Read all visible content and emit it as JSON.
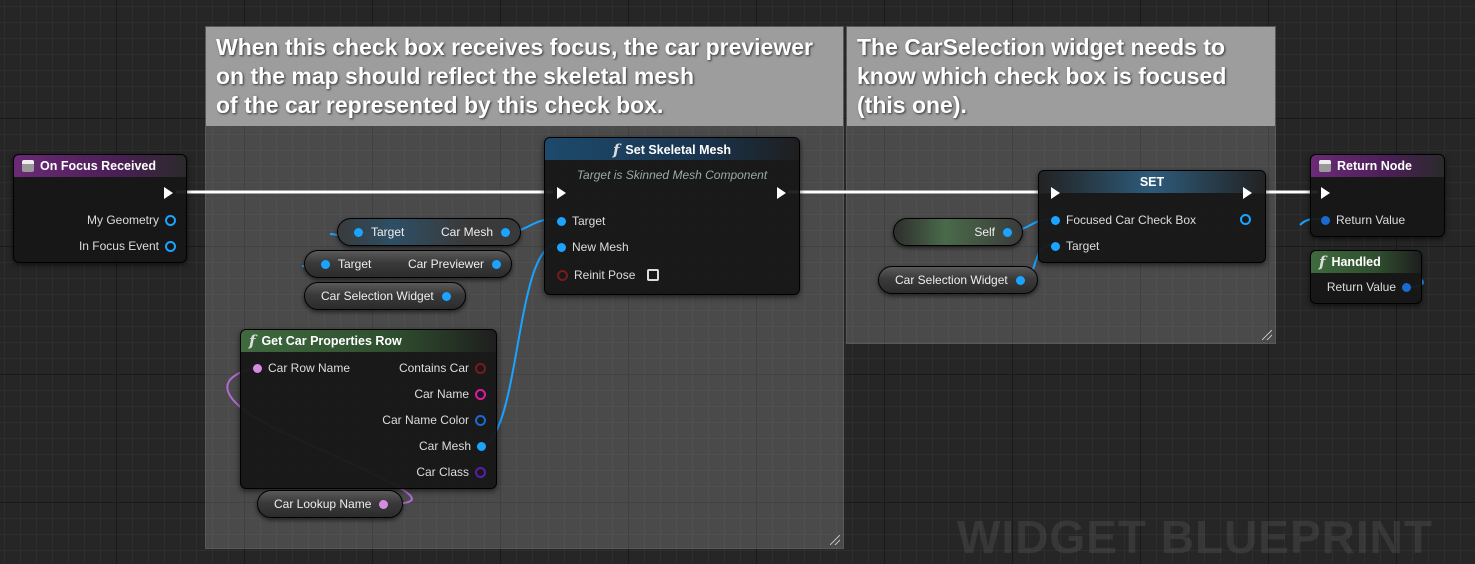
{
  "comments": {
    "left": "When this check box receives focus, the car previewer\non the map should reflect the skeletal mesh\nof the car represented by this check box.",
    "right": "The CarSelection widget needs to\nknow which check box is focused\n(this one)."
  },
  "on_focus": {
    "title": "On Focus Received",
    "pins": [
      "My Geometry",
      "In Focus Event"
    ]
  },
  "set_mesh": {
    "title": "Set Skeletal Mesh",
    "subtitle": "Target is Skinned Mesh Component",
    "pins": [
      "Target",
      "New Mesh",
      "Reinit Pose"
    ]
  },
  "get_row": {
    "title": "Get Car Properties Row",
    "input": "Car Row Name",
    "outputs": [
      "Contains Car",
      "Car Name",
      "Car Name Color",
      "Car Mesh",
      "Car Class"
    ]
  },
  "vars": {
    "car_mesh": {
      "left": "Target",
      "right": "Car Mesh"
    },
    "car_previewer": {
      "left": "Target",
      "right": "Car Previewer"
    },
    "car_sel_1": "Car Selection Widget",
    "car_lookup": "Car Lookup Name",
    "self": "Self",
    "car_sel_2": "Car Selection Widget"
  },
  "set_node": {
    "title": "SET",
    "pins": [
      "Focused Car Check Box",
      "Target"
    ]
  },
  "return_node": {
    "title": "Return Node",
    "pin": "Return Value"
  },
  "handled": {
    "title": "Handled",
    "pin": "Return Value"
  },
  "watermark": "WIDGET BLUEPRINT",
  "colors": {
    "object_pin": "#1aa3ff",
    "struct_pin": "#7a1a1a",
    "name_pin": "#d58be0",
    "text_pin": "#e01aa0",
    "class_pin": "#5a1fa8",
    "exec": "#ffffff"
  }
}
